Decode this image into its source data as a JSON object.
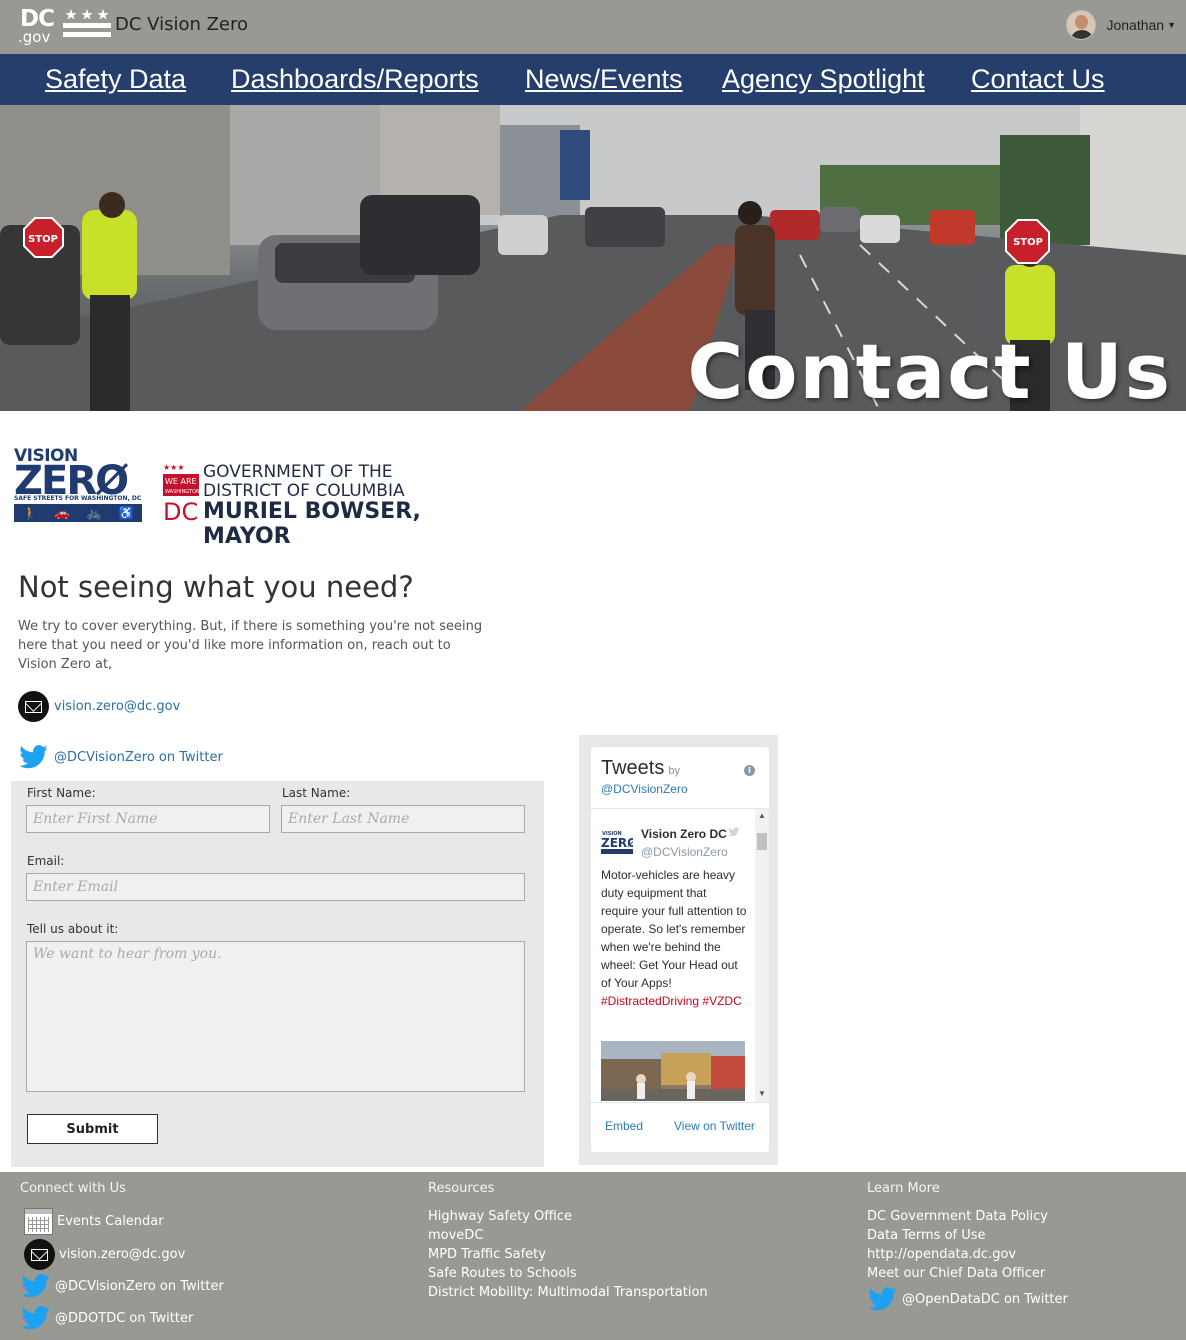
{
  "header": {
    "logo_dc": "DC",
    "logo_gov": ".gov",
    "site_title": "DC Vision Zero",
    "user_name": "Jonathan",
    "icons": {
      "user": "avatar",
      "menu": "caret-down-icon"
    }
  },
  "nav": {
    "items": [
      {
        "label": "Safety Data"
      },
      {
        "label": "Dashboards/Reports"
      },
      {
        "label": "News/Events"
      },
      {
        "label": "Agency Spotlight"
      },
      {
        "label": "Contact Us"
      }
    ]
  },
  "hero": {
    "title": "Contact Us",
    "stop_sign_text": "STOP"
  },
  "logos": {
    "vision_zero": {
      "vision": "VISION",
      "zero": "ZERØ",
      "tagline": "SAFE STREETS FOR WASHINGTON, DC"
    },
    "government": {
      "line1": "GOVERNMENT OF THE",
      "line2": "DISTRICT OF COLUMBIA",
      "line3": "MURIEL BOWSER, MAYOR",
      "badge_text": "WE ARE WASHINGTON DC"
    }
  },
  "intro": {
    "title": "Not seeing what you need?",
    "text": "We try to cover everything. But, if there is something you're not seeing here that you need or you'd like more information on, reach out to Vision Zero at,",
    "email": "vision.zero@dc.gov",
    "twitter": "@DCVisionZero on Twitter"
  },
  "form": {
    "first_name_label": "First Name:",
    "first_name_placeholder": "Enter First Name",
    "last_name_label": "Last Name:",
    "last_name_placeholder": "Enter Last Name",
    "email_label": "Email:",
    "email_placeholder": "Enter Email",
    "message_label": "Tell us about it:",
    "message_placeholder": "We want to hear from you.",
    "submit_label": "Submit"
  },
  "twitter_widget": {
    "title": "Tweets",
    "by": "by",
    "handle": "@DCVisionZero",
    "author_name": "Vision Zero DC",
    "author_handle": "@DCVisionZero",
    "tweet_text": "Motor-vehicles are heavy duty equipment that require your full attention to operate. So let's remember when we're behind the wheel: Get Your Head out of Your Apps!",
    "hashtag1": "#DistractedDriving",
    "hashtag2": "#VZDC",
    "embed_label": "Embed",
    "view_label": "View on Twitter",
    "colors": {
      "link": "#2b7bb9",
      "hashtag": "#d0021b"
    }
  },
  "footer": {
    "connect": {
      "title": "Connect with Us",
      "items": [
        "Events Calendar",
        "vision.zero@dc.gov",
        "@DCVisionZero on Twitter",
        "@DDOTDC on Twitter"
      ]
    },
    "resources": {
      "title": "Resources",
      "items": [
        "Highway Safety Office",
        "moveDC",
        "MPD Traffic Safety",
        "Safe Routes to Schools",
        "District Mobility: Multimodal Transportation"
      ]
    },
    "learn": {
      "title": "Learn More",
      "items": [
        "DC Government Data Policy",
        "Data Terms of Use",
        "http://opendata.dc.gov",
        "Meet our Chief Data Officer",
        "@OpenDataDC on Twitter"
      ]
    }
  },
  "colors": {
    "header_bg": "#999994",
    "nav_bg": "#253e6c",
    "link": "#2b6fa8",
    "twitter_blue": "#1da1f2",
    "brand_navy": "#1f3b70",
    "brand_red": "#c8102e"
  }
}
